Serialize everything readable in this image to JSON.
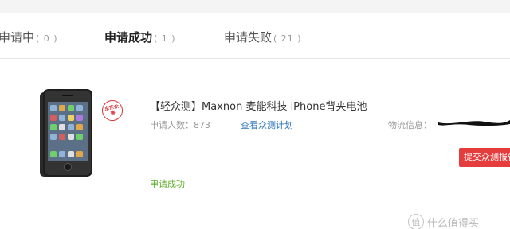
{
  "tabs": [
    {
      "label": "申请中",
      "count": "( 0 )",
      "active": false
    },
    {
      "label": "申请成功",
      "count": "( 1 )",
      "active": true
    },
    {
      "label": "申请失败",
      "count": "( 21 )",
      "active": false
    }
  ],
  "item": {
    "badge_text": "京东众筹",
    "title": "【轻众测】Maxnon 麦能科技 iPhone背夹电池",
    "applicants": "申请人数：873",
    "plan_link": "查看众测计划",
    "logistics_label": "物流信息：",
    "submit_label": "提交众测报告",
    "status": "申请成功"
  },
  "watermark": {
    "text": "什么值得买",
    "icon": "值"
  },
  "colors": {
    "accent_red": "#e53d3d",
    "link_blue": "#2b74b9",
    "success_green": "#5fae2e"
  }
}
